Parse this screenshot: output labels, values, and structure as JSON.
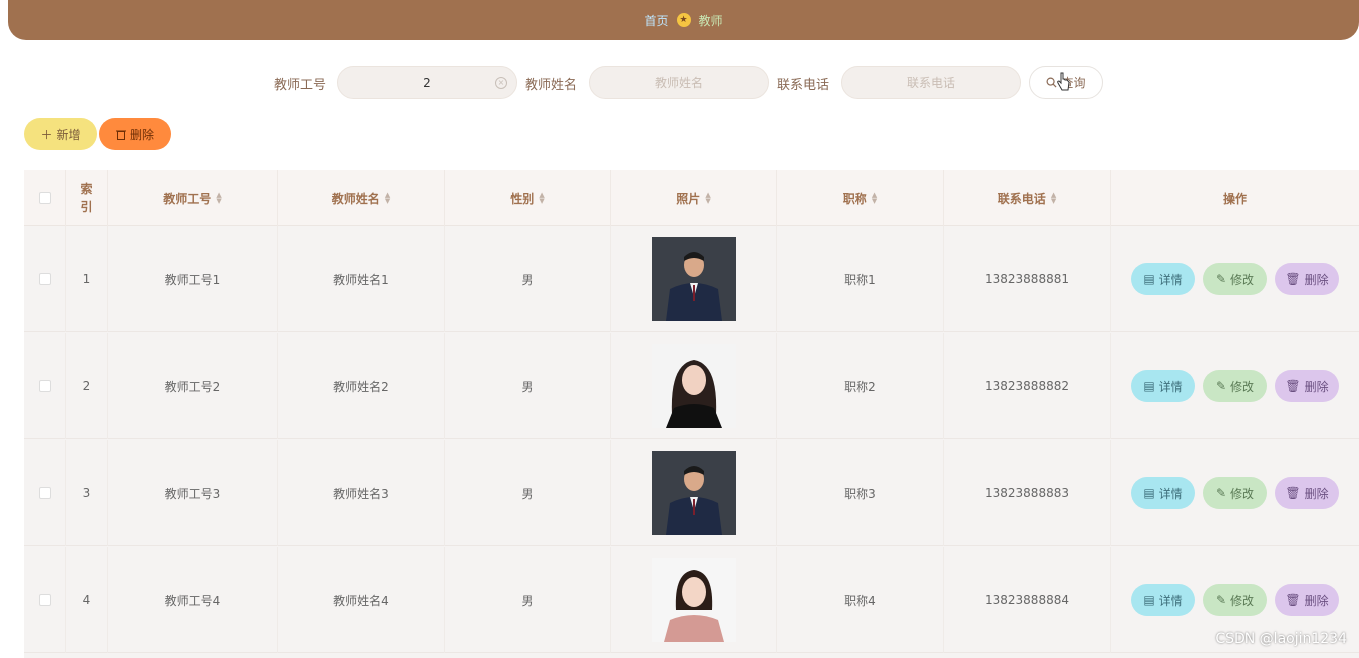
{
  "breadcrumb": {
    "home": "首页",
    "current": "教师"
  },
  "search": {
    "fields": [
      {
        "label": "教师工号",
        "value": "2",
        "placeholder": "教师工号"
      },
      {
        "label": "教师姓名",
        "value": "",
        "placeholder": "教师姓名"
      },
      {
        "label": "联系电话",
        "value": "",
        "placeholder": "联系电话"
      }
    ],
    "query_label": "查询"
  },
  "actions": {
    "add_label": "新增",
    "delete_label": "删除"
  },
  "table": {
    "headers": [
      "索引",
      "教师工号",
      "教师姓名",
      "性别",
      "照片",
      "职称",
      "联系电话",
      "操作"
    ],
    "rows": [
      {
        "index": "1",
        "id": "教师工号1",
        "name": "教师姓名1",
        "gender": "男",
        "title": "职称1",
        "phone": "13823888881",
        "photo": "man-in-suit"
      },
      {
        "index": "2",
        "id": "教师工号2",
        "name": "教师姓名2",
        "gender": "男",
        "title": "职称2",
        "phone": "13823888882",
        "photo": "woman-long-hair"
      },
      {
        "index": "3",
        "id": "教师工号3",
        "name": "教师姓名3",
        "gender": "男",
        "title": "职称3",
        "phone": "13823888883",
        "photo": "man-in-suit"
      },
      {
        "index": "4",
        "id": "教师工号4",
        "name": "教师姓名4",
        "gender": "男",
        "title": "职称4",
        "phone": "13823888884",
        "photo": "woman-smiling"
      }
    ],
    "row_actions": {
      "detail": "详情",
      "edit": "修改",
      "remove": "删除"
    }
  },
  "watermark": "CSDN @laojin1234",
  "colors": {
    "topbar": "#a0714f",
    "header_text": "#a0714f",
    "add_button": "#f5e27e",
    "delete_button": "#ff8a3d"
  }
}
